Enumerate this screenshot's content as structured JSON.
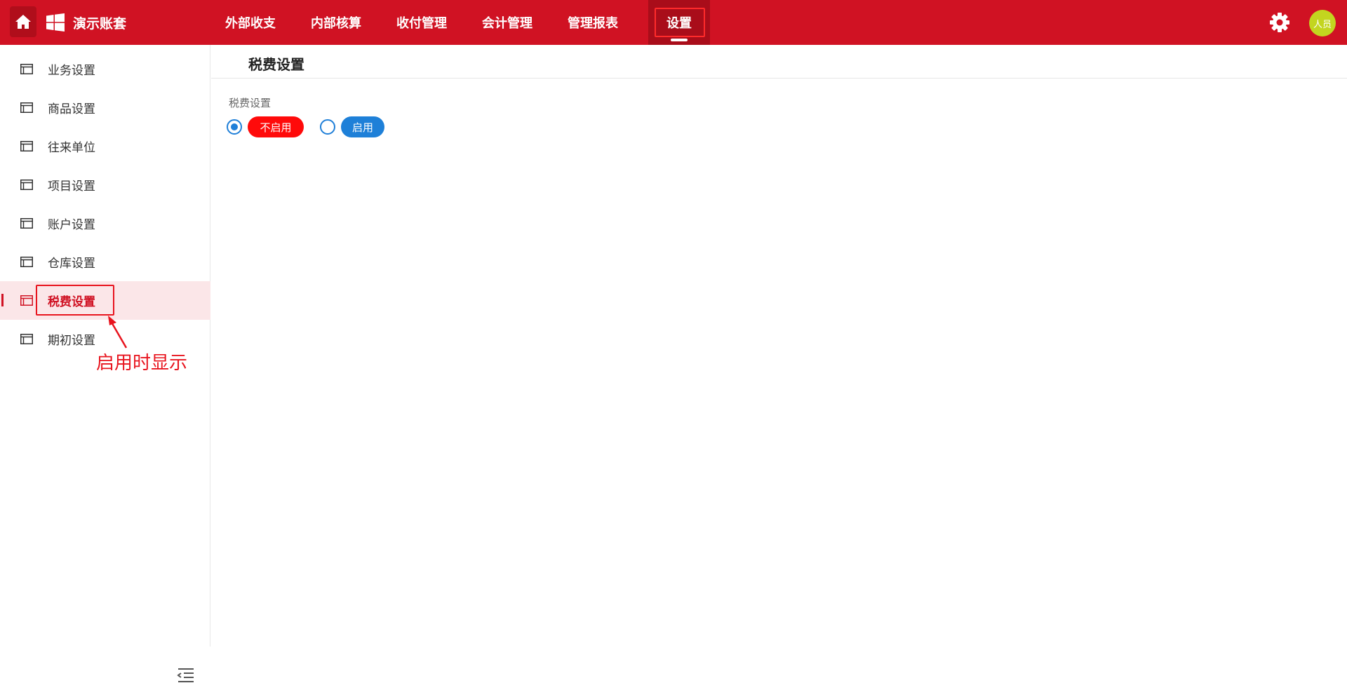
{
  "header": {
    "app_name": "演示账套",
    "home_icon": "home-icon",
    "logo_icon": "windows-logo-icon",
    "nav": [
      {
        "label": "外部收支"
      },
      {
        "label": "内部核算"
      },
      {
        "label": "收付管理"
      },
      {
        "label": "会计管理"
      },
      {
        "label": "管理报表"
      },
      {
        "label": "设置",
        "active": true
      }
    ],
    "avatar_text": "人员",
    "colors": {
      "brand": "#d01223",
      "active_tab": "#a90d1a",
      "avatar": "#c3d51f"
    }
  },
  "sidebar": {
    "items": [
      {
        "label": "业务设置"
      },
      {
        "label": "商品设置"
      },
      {
        "label": "往来单位"
      },
      {
        "label": "项目设置"
      },
      {
        "label": "账户设置"
      },
      {
        "label": "仓库设置"
      },
      {
        "label": "税费设置",
        "active": true
      },
      {
        "label": "期初设置"
      }
    ],
    "annotation": "启用时显示"
  },
  "main": {
    "title": "税费设置",
    "field_label": "税费设置",
    "options": [
      {
        "label": "不启用",
        "selected": true,
        "color": "#ff0a0a"
      },
      {
        "label": "启用",
        "selected": false,
        "color": "#1e80d8"
      }
    ]
  }
}
